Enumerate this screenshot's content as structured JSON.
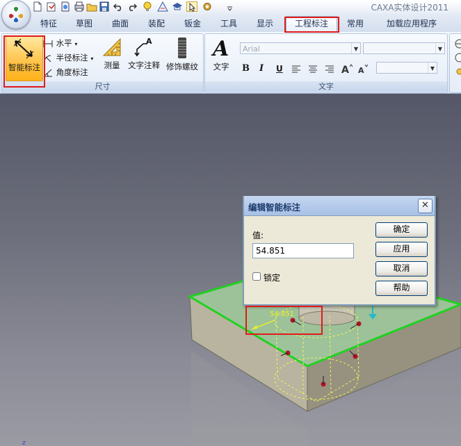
{
  "window": {
    "title": "CAXA实体设计2011"
  },
  "tabs": [
    {
      "label": "特征",
      "active": false
    },
    {
      "label": "草图",
      "active": false
    },
    {
      "label": "曲面",
      "active": false
    },
    {
      "label": "装配",
      "active": false
    },
    {
      "label": "钣金",
      "active": false
    },
    {
      "label": "工具",
      "active": false
    },
    {
      "label": "显示",
      "active": false
    },
    {
      "label": "工程标注",
      "active": true
    },
    {
      "label": "常用",
      "active": false
    },
    {
      "label": "加载应用程序",
      "active": false
    }
  ],
  "ribbon": {
    "dimension_group": {
      "label": "尺寸",
      "smart_dimension": "智能标注",
      "horizontal": "水平",
      "radius": "半径标注",
      "angle": "角度标注",
      "measure": "测量",
      "text_annotation": "文字注释",
      "thread": "修饰螺纹"
    },
    "text_group": {
      "label": "文字",
      "text_button": "文字",
      "font_combo": "Arial",
      "size_combo": "",
      "style_combo": "",
      "format_buttons": [
        "B",
        "I",
        "U"
      ]
    }
  },
  "scene": {
    "dimension_value_label": "54.851",
    "axis_label": "z"
  },
  "dialog": {
    "title": "编辑智能标注",
    "value_label": "值:",
    "value": "54.851",
    "lock_label": "锁定",
    "ok_button": "确定",
    "apply_button": "应用",
    "cancel_button": "取消",
    "help_button": "帮助"
  },
  "colors": {
    "highlight_box": "#e01a1a",
    "face_edge": "#22d022",
    "dimension": "#f0f020",
    "ribbon_bg": "#e2eaf6",
    "dialog_bg": "#ece9d8"
  }
}
